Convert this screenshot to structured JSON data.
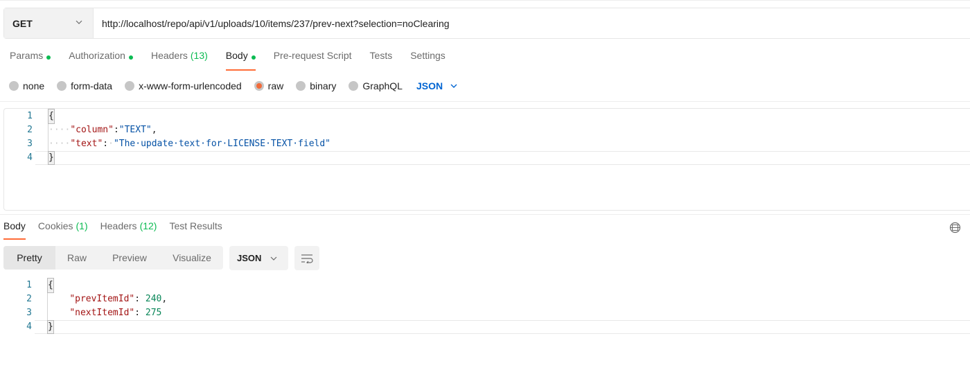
{
  "request": {
    "method": "GET",
    "url": "http://localhost/repo/api/v1/uploads/10/items/237/prev-next?selection=noClearing",
    "tabs": [
      {
        "label": "Params",
        "dot": true
      },
      {
        "label": "Authorization",
        "dot": true
      },
      {
        "label": "Headers",
        "count": "(13)"
      },
      {
        "label": "Body",
        "dot": true,
        "active": true
      },
      {
        "label": "Pre-request Script"
      },
      {
        "label": "Tests"
      },
      {
        "label": "Settings"
      }
    ],
    "body_types": [
      "none",
      "form-data",
      "x-www-form-urlencoded",
      "raw",
      "binary",
      "GraphQL"
    ],
    "body_type_selected": "raw",
    "language": "JSON",
    "editor": {
      "line_numbers": [
        "1",
        "2",
        "3",
        "4"
      ],
      "open_brace": "{",
      "close_brace": "}",
      "ws4": "····",
      "key1": "\"column\"",
      "colon1": ":",
      "val1": "\"TEXT\"",
      "comma": ",",
      "key2": "\"text\"",
      "colon2": ":",
      "ws1": "·",
      "val2": "\"The·update·text·for·LICENSE·TEXT·field\""
    }
  },
  "response": {
    "tabs": [
      {
        "label": "Body",
        "active": true
      },
      {
        "label": "Cookies",
        "count": "(1)"
      },
      {
        "label": "Headers",
        "count": "(12)"
      },
      {
        "label": "Test Results"
      }
    ],
    "views": [
      "Pretty",
      "Raw",
      "Preview",
      "Visualize"
    ],
    "view_selected": "Pretty",
    "format": "JSON",
    "editor": {
      "line_numbers": [
        "1",
        "2",
        "3",
        "4"
      ],
      "open_brace": "{",
      "close_brace": "}",
      "indent": "    ",
      "key1": "\"prevItemId\"",
      "colon": ": ",
      "val1": "240",
      "comma": ",",
      "key2": "\"nextItemId\"",
      "val2": "275"
    }
  },
  "colors": {
    "accent": "#ff6c37",
    "status_dot": "#0cbb52",
    "link_blue": "#0265d2"
  }
}
